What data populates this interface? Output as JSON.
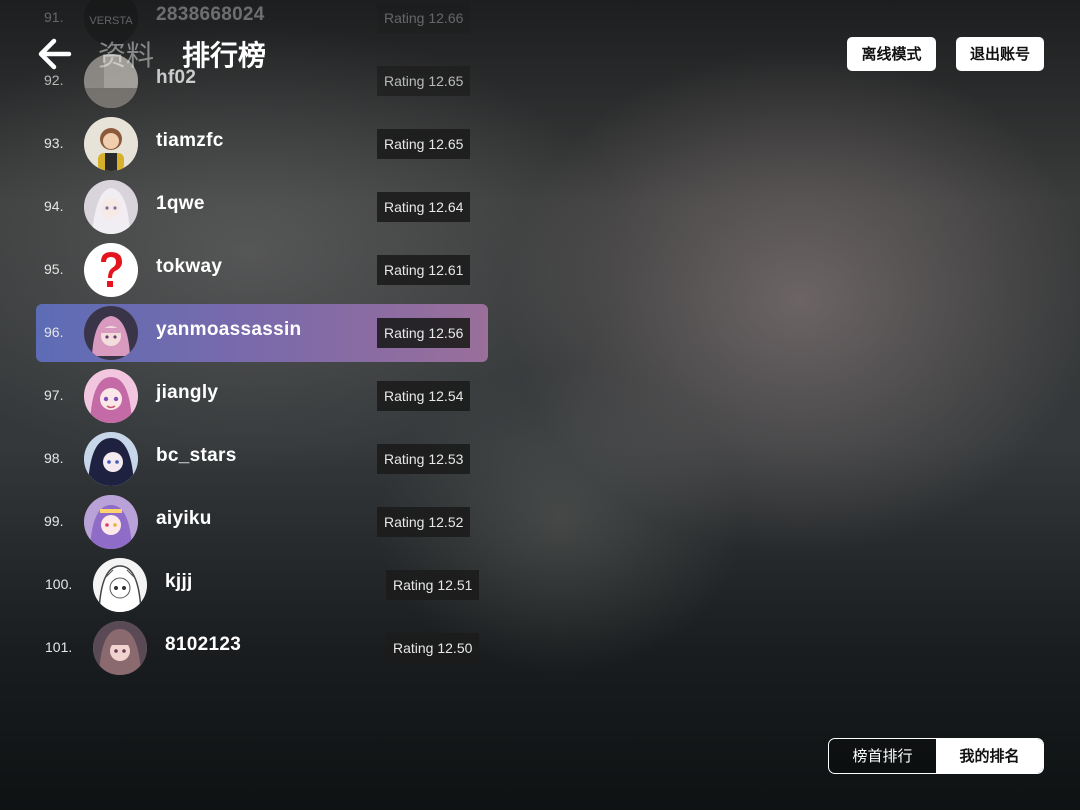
{
  "header": {
    "back_icon": "arrow-left-icon",
    "tab_info": "资料",
    "tab_leaderboard": "排行榜",
    "offline_button": "离线模式",
    "logout_button": "退出账号"
  },
  "leaderboard": [
    {
      "rank": "91.",
      "name": "2838668024",
      "rating": "Rating 12.66",
      "avatar": "versta-logo-avatar"
    },
    {
      "rank": "92.",
      "name": "hf02",
      "rating": "Rating 12.65",
      "avatar": "photo-avatar"
    },
    {
      "rank": "93.",
      "name": "tiamzfc",
      "rating": "Rating 12.65",
      "avatar": "person-avatar"
    },
    {
      "rank": "94.",
      "name": "1qwe",
      "rating": "Rating 12.64",
      "avatar": "anime-avatar"
    },
    {
      "rank": "95.",
      "name": "tokway",
      "rating": "Rating 12.61",
      "avatar": "question-mark-avatar"
    },
    {
      "rank": "96.",
      "name": "yanmoassassin",
      "rating": "Rating 12.56",
      "avatar": "anime-avatar",
      "highlight": true
    },
    {
      "rank": "97.",
      "name": "jiangly",
      "rating": "Rating 12.54",
      "avatar": "anime-avatar"
    },
    {
      "rank": "98.",
      "name": "bc_stars",
      "rating": "Rating 12.53",
      "avatar": "anime-avatar"
    },
    {
      "rank": "99.",
      "name": "aiyiku",
      "rating": "Rating 12.52",
      "avatar": "anime-avatar"
    },
    {
      "rank": "100.",
      "name": "kjjj",
      "rating": "Rating 12.51",
      "avatar": "manga-avatar"
    },
    {
      "rank": "101.",
      "name": "8102123",
      "rating": "Rating 12.50",
      "avatar": "anime-avatar"
    }
  ],
  "avatar_text": "VERSTA",
  "segment": {
    "top_ranking": "榜首排行",
    "my_ranking": "我的排名",
    "selected": "我的排名"
  },
  "colors": {
    "highlight_start": "#5d6cb6",
    "highlight_end": "#9a6f9a",
    "rating_bg": "#1c1c1c"
  }
}
